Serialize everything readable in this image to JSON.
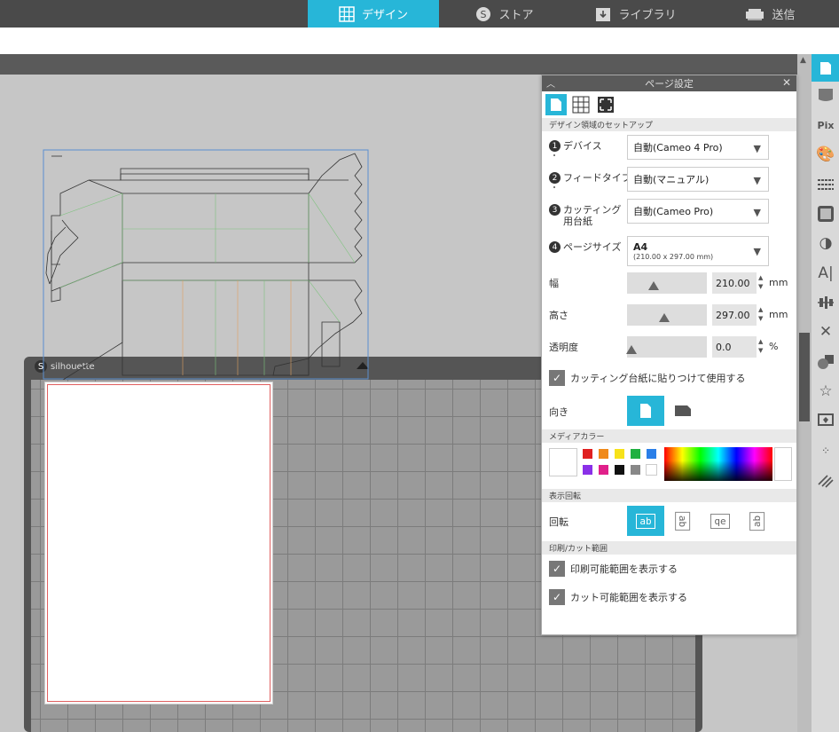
{
  "nav": {
    "tabs": [
      {
        "label": "デザイン",
        "icon": "grid-icon",
        "active": true
      },
      {
        "label": "ストア",
        "icon": "silhouette-s-icon",
        "active": false
      },
      {
        "label": "ライブラリ",
        "icon": "download-box-icon",
        "active": false
      },
      {
        "label": "送信",
        "icon": "cutter-icon",
        "active": false
      }
    ]
  },
  "mat": {
    "brand": "silhouette"
  },
  "panel": {
    "title": "ページ設定",
    "section_setup": "デザイン領域のセットアップ",
    "device_label": "デバイス",
    "device_value": "自動(Cameo 4 Pro)",
    "feed_label": "フィードタイプ",
    "feed_value": "自動(マニュアル)",
    "mat_label": "カッティング用台紙",
    "mat_value": "自動(Cameo Pro)",
    "size_label": "ページサイズ",
    "size_value": "A4",
    "size_sub": "(210.00 x 297.00 mm)",
    "width_label": "幅",
    "width_value": "210.00",
    "width_unit": "mm",
    "height_label": "高さ",
    "height_value": "297.00",
    "height_unit": "mm",
    "opacity_label": "透明度",
    "opacity_value": "0.0",
    "opacity_unit": "%",
    "use_mat_label": "カッティング台紙に貼りつけて使用する",
    "orientation_label": "向き",
    "section_media": "メディアカラー",
    "section_rotate": "表示回転",
    "rotate_label": "回転",
    "section_print": "印刷/カット範囲",
    "show_print_label": "印刷可能範囲を表示する",
    "show_cut_label": "カット可能範囲を表示する",
    "nums": [
      "1",
      "2",
      "3",
      "4"
    ],
    "rot_glyphs": [
      "ab",
      "ab",
      "qe",
      "ab"
    ]
  },
  "colors": {
    "accent": "#27b6d8",
    "swatches": [
      "#e02020",
      "#f08a1a",
      "#f7e21a",
      "#20b040",
      "#2a7fe8",
      "#8a30e8",
      "#e0208a",
      "#111111",
      "#888888",
      "#ffffff"
    ]
  },
  "sidebar_icons": [
    "page-icon",
    "mat-icon",
    "pix-icon",
    "palette-icon",
    "line-style-icon",
    "fill-pattern-icon",
    "contrast-icon",
    "text-icon",
    "align-icon",
    "transform-icon",
    "replicate-icon",
    "star-icon",
    "trace-icon",
    "dots-icon",
    "offset-icon"
  ]
}
